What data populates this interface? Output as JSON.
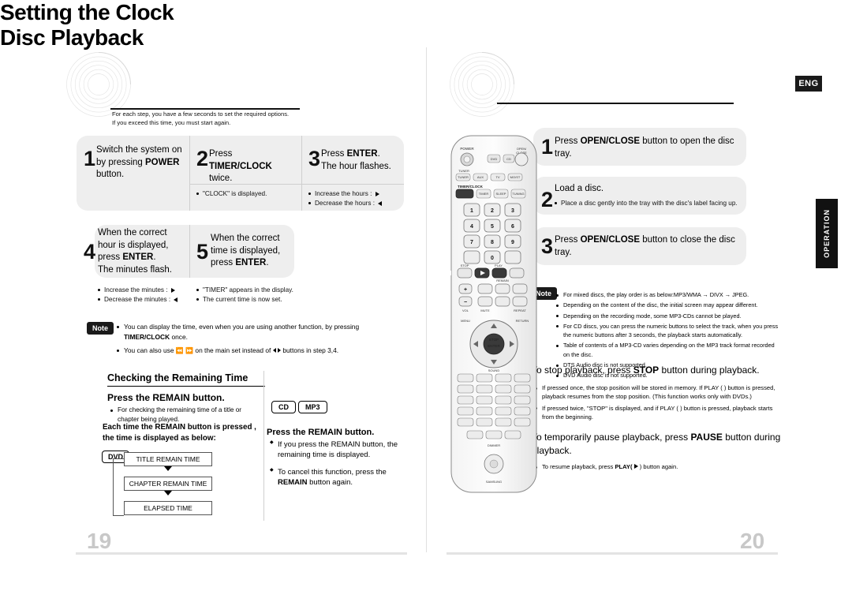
{
  "doc": {
    "language_badge": "ENG",
    "side_tab": "OPERATION",
    "left_page_number": "19",
    "right_page_number": "20"
  },
  "left": {
    "title": "Setting the Clock",
    "subtitle_line1": "For each step, you have a few seconds to set the required options.",
    "subtitle_line2": "If you exceed this time, you must start again.",
    "steps": [
      {
        "num": "1",
        "text_parts": [
          "Switch the system on by pressing ",
          "POWER",
          " button."
        ],
        "bullets": []
      },
      {
        "num": "2",
        "text_parts": [
          "Press ",
          "TIMER/CLOCK",
          " twice."
        ],
        "bullets": [
          "\"CLOCK\" is displayed."
        ]
      },
      {
        "num": "3",
        "text_parts": [
          "Press ",
          "ENTER",
          ".\nThe hour flashes."
        ],
        "bullets": [
          "Increase the hours :",
          "Decrease the hours :"
        ]
      },
      {
        "num": "4",
        "text_parts": [
          "When the correct hour is displayed, press ",
          "ENTER",
          ".\nThe minutes flash."
        ],
        "bullets": [
          "Increase the minutes :",
          "Decrease the minutes :"
        ]
      },
      {
        "num": "5",
        "text_parts": [
          "When the correct time is displayed, press ",
          "ENTER",
          "."
        ],
        "bullets": [
          "\"TIMER\" appears in the display.",
          "The current time is now set."
        ]
      }
    ],
    "note": {
      "label": "Note",
      "items": [
        "You can display the time, even when you are using another function, by pressing TIMER/CLOCK once.",
        "You can also use  on the main set instead of  buttons in step 3,4."
      ],
      "item1_a": "You can display the time, even when you are using another function, by pressing",
      "item1_b": "TIMER/CLOCK",
      "item1_c": "once.",
      "item2_a": "You can also use",
      "item2_b": "on the main set instead of",
      "item2_c": "buttons in step 3,4."
    },
    "remaining": {
      "heading": "Checking the Remaining Time",
      "press_remain": "Press the REMAIN button.",
      "press_remain_plain": "Press the ",
      "press_remain_bold": "REMAIN",
      "press_remain_tail": " button.",
      "bullet": "For checking the remaining time of a title or chapter being played.",
      "each_time_line1": "Each time the REMAIN button is pressed ,",
      "each_time_line2": "the time is displayed as below:",
      "badges": [
        "CD",
        "MP3"
      ],
      "dvd_badge": "DVD",
      "flow": [
        "TITLE REMAIN TIME",
        "CHAPTER REMAIN TIME",
        "ELAPSED TIME"
      ],
      "right_heading": "Press the REMAIN button.",
      "right_items": [
        "If you press the REMAIN button, the remaining time is displayed.",
        "To cancel this function, press the REMAIN button again."
      ],
      "right_item2_a": "To cancel this function, press the",
      "right_item2_b": "REMAIN",
      "right_item2_c": " button again."
    }
  },
  "right": {
    "title": "Disc Playback",
    "steps": [
      {
        "num": "1",
        "line_a": "Press ",
        "line_b": "OPEN/CLOSE",
        "line_c": " button to open the disc tray.",
        "bullets": []
      },
      {
        "num": "2",
        "line_a": "",
        "line_b": "",
        "line_c": "Load a disc.",
        "bullets": [
          "Place a disc gently into the tray with the disc's label facing up."
        ]
      },
      {
        "num": "3",
        "line_a": "Press ",
        "line_b": "OPEN/CLOSE",
        "line_c": " button to close the disc tray.",
        "bullets": []
      }
    ],
    "note": {
      "label": "Note",
      "items": [
        "For mixed discs, the play order is as below:MP3/WMA → DIVX → JPEG.",
        "Depending on the content of the disc, the initial screen may appear different.",
        "Depending on the recording mode, some MP3-CDs cannot be played.",
        "For CD discs, you can press the numeric buttons to select the track, when you press the numeric buttons after 3 seconds, the playback starts automatically.",
        "Table of contents of a MP3-CD varies depending on the MP3 track format recorded on the disc.",
        "DTS Audio disc is not supported.",
        "DVD Audio disc is not supported."
      ]
    },
    "stop_line_a": "To stop playback, press ",
    "stop_line_b": "STOP",
    "stop_line_c": " button during playback.",
    "stop_bullets": [
      "If pressed once,  the stop position will be stored in memory. If PLAY (  ) button is pressed, playback resumes from the stop position. (This function works only with DVDs.)",
      "If pressed twice, \"STOP\" is displayed, and if PLAY (  ) button is pressed, playback starts from the beginning."
    ],
    "pause_line_a": "To temporarily pause playback, press ",
    "pause_line_b": "PAUSE",
    "pause_line_c": " button during playback.",
    "pause_bullet_a": "To resume playback, press ",
    "pause_bullet_b": "PLAY(",
    "pause_bullet_c": " ) button again."
  },
  "remote": {
    "labels": {
      "power": "POWER",
      "open_close": "OPEN/CLOSE",
      "tuner": "TUNER",
      "timer_clock": "TIMER/CLOCK",
      "vol": "VOL",
      "stop": "STOP",
      "play": "PLAY",
      "enter": "ENTER",
      "remain": "REMAIN"
    }
  },
  "colors": {
    "box_gray": "#eeeeee",
    "badge_black": "#1a1a1a",
    "page_number": "#c8c8c8",
    "rule": "#cfcfcf"
  }
}
